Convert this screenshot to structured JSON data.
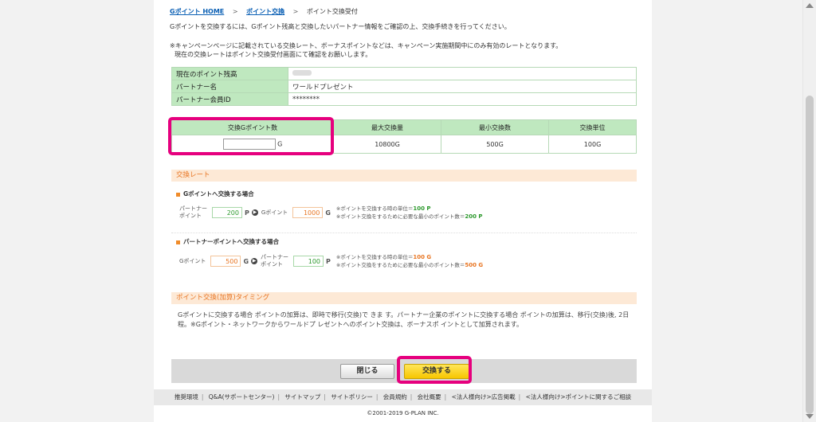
{
  "breadcrumb": {
    "home": "Gポイント HOME",
    "exchange": "ポイント交換",
    "current": "ポイント交換受付"
  },
  "intro": "Gポイントを交換するには、Gポイント残高と交換したいパートナー情報をご確認の上、交換手続きを行ってください。",
  "note_line1": "※キャンペーンページに記載されている交換レート、ボーナスポイントなどは、キャンペーン実施期間中にのみ有効のレートとなります。",
  "note_line2": "現在の交換レートはポイント交換受付画面にて確認をお願いします。",
  "info": {
    "balance_label": "現在のポイント残高",
    "partner_label": "パートナー名",
    "partner_value": "ワールドプレゼント",
    "member_label": "パートナー会員ID",
    "member_value": "********"
  },
  "exchange_table": {
    "col1": "交換Gポイント数",
    "col2": "最大交換量",
    "col3": "最小交換数",
    "col4": "交換単位",
    "unit_g": "G",
    "max": "10800G",
    "min": "500G",
    "step": "100G"
  },
  "rate_section": {
    "title": "交換レート",
    "to_g_title": "Gポイントへ交換する場合",
    "partner_point_label_1": "パートナー",
    "partner_point_label_2": "ポイント",
    "gpoint_label": "Gポイント",
    "to_g_partner_value": "200",
    "to_g_gpoint_value": "1000",
    "unit_p": "P",
    "unit_g": "G",
    "to_g_note1": "※ポイントを交換する時の単位＝",
    "to_g_note1_value": "100 P",
    "to_g_note2": "※ポイント交換をするために必要な最小のポイント数＝",
    "to_g_note2_value": "200 P",
    "to_p_title": "パートナーポイントへ交換する場合",
    "to_p_gpoint_value": "500",
    "to_p_partner_value": "100",
    "to_p_note1": "※ポイントを交換する時の単位＝",
    "to_p_note1_value": "100 G",
    "to_p_note2": "※ポイント交換をするために必要な最小のポイント数＝",
    "to_p_note2_value": "500 G"
  },
  "timing_section": {
    "title": "ポイント交換(加算)タイミング",
    "text": "Gポイントに交換する場合 ポイントの加算は、即時で移行(交換)で きま す。パートナー企業のポイントに交換する場合 ポイントの加算は、移行(交換)後, 2日 程。※Gポイント・ネットワークからワールドプ レゼントへのポイント交換は、ボーナスポ イントとして加算されます。"
  },
  "buttons": {
    "close": "閉じる",
    "submit": "交換する"
  },
  "footer": {
    "links": [
      "推奨環境",
      "Q&A(サポートセンター)",
      "サイトマップ",
      "サイトポリシー",
      "会員規約",
      "会社概要",
      "<法人様向け>広告掲載",
      "<法人様向け>ポイントに関するご相談"
    ],
    "copyright": "©2001-2019 G-PLAN INC."
  },
  "colors": {
    "highlight": "#e6007e",
    "table_header": "#bfe8bf",
    "section_bg": "#fde9d6",
    "accent_orange": "#e87522",
    "accent_green": "#2f9a2f"
  }
}
